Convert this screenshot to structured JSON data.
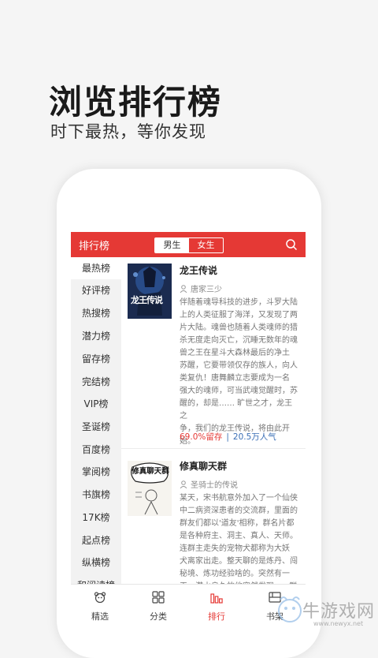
{
  "hero": {
    "title": "浏览排行榜",
    "subtitle": "时下最热，等你发现"
  },
  "app": {
    "header_title": "排行榜",
    "gender_tabs": [
      {
        "label": "男生",
        "active": true
      },
      {
        "label": "女生",
        "active": false
      }
    ],
    "search_icon": "search-icon",
    "accent_color": "#e53935"
  },
  "sidebar": {
    "items": [
      {
        "label": "最热榜",
        "active": true
      },
      {
        "label": "好评榜",
        "active": false
      },
      {
        "label": "热搜榜",
        "active": false
      },
      {
        "label": "潜力榜",
        "active": false
      },
      {
        "label": "留存榜",
        "active": false
      },
      {
        "label": "完结榜",
        "active": false
      },
      {
        "label": "VIP榜",
        "active": false
      },
      {
        "label": "圣诞榜",
        "active": false
      },
      {
        "label": "百度榜",
        "active": false
      },
      {
        "label": "掌阅榜",
        "active": false
      },
      {
        "label": "书旗榜",
        "active": false
      },
      {
        "label": "17K榜",
        "active": false
      },
      {
        "label": "起点榜",
        "active": false
      },
      {
        "label": "纵横榜",
        "active": false
      },
      {
        "label": "和阅读榜",
        "active": false
      }
    ]
  },
  "books": [
    {
      "title": "龙王传说",
      "author": "唐家三少",
      "cover_text": "龙王传说",
      "description": [
        "伴随着魂导科技的进步，斗罗大陆",
        "上的人类征服了海洋，又发现了两",
        "片大陆。魂兽也随着人类魂师的猎",
        "杀无度走向灭亡，沉睡无数年的魂",
        "兽之王在星斗大森林最后的净土",
        "苏醒，它要带领仅存的族人，向人",
        "类复仇！唐舞麟立志要成为一名",
        "强大的魂师，可当武魂觉醒时，苏",
        "醒的，却是…… 旷世之才，龙王之",
        "争，我们的龙王传说，将由此开",
        "始。"
      ],
      "retention": "69.0%留存",
      "separator": "|",
      "popularity": "20.5万人气"
    },
    {
      "title": "修真聊天群",
      "author": "圣骑士的传说",
      "cover_text": "修真聊天群",
      "description": [
        "某天，宋书航意外加入了一个仙侠",
        "中二病资深患者的交流群，里面的",
        "群友们都以'道友'相称，群名片都",
        "是各种府主、洞主、真人、天师。",
        "连群主走失的宠物犬都称为大妖",
        "犬离家出走。整天聊的是炼丹、闯",
        "秘境、炼功经验啥的。突然有一",
        "天，潜水良久的他突然发现......群"
      ]
    }
  ],
  "tabbar": {
    "tabs": [
      {
        "label": "精选",
        "icon": "bear-icon",
        "active": false
      },
      {
        "label": "分类",
        "icon": "grid-icon",
        "active": false
      },
      {
        "label": "排行",
        "icon": "bar-chart-icon",
        "active": true
      },
      {
        "label": "书架",
        "icon": "bookshelf-icon",
        "active": false
      }
    ]
  },
  "watermark": {
    "text": "牛游戏网",
    "url": "www.newyx.net"
  }
}
